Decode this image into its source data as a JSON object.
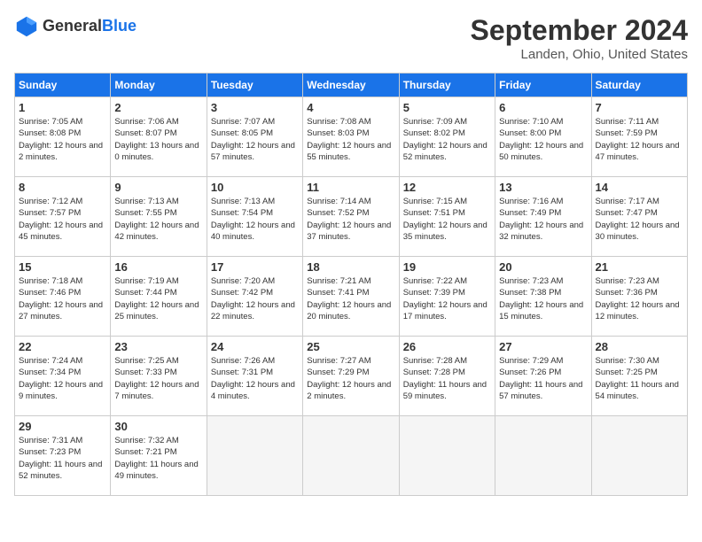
{
  "header": {
    "logo_general": "General",
    "logo_blue": "Blue",
    "month_year": "September 2024",
    "location": "Landen, Ohio, United States"
  },
  "days_of_week": [
    "Sunday",
    "Monday",
    "Tuesday",
    "Wednesday",
    "Thursday",
    "Friday",
    "Saturday"
  ],
  "weeks": [
    [
      {
        "day": 1,
        "sunrise": "7:05 AM",
        "sunset": "8:08 PM",
        "daylight": "12 hours and 2 minutes"
      },
      {
        "day": 2,
        "sunrise": "7:06 AM",
        "sunset": "8:07 PM",
        "daylight": "13 hours and 0 minutes"
      },
      {
        "day": 3,
        "sunrise": "7:07 AM",
        "sunset": "8:05 PM",
        "daylight": "12 hours and 57 minutes"
      },
      {
        "day": 4,
        "sunrise": "7:08 AM",
        "sunset": "8:03 PM",
        "daylight": "12 hours and 55 minutes"
      },
      {
        "day": 5,
        "sunrise": "7:09 AM",
        "sunset": "8:02 PM",
        "daylight": "12 hours and 52 minutes"
      },
      {
        "day": 6,
        "sunrise": "7:10 AM",
        "sunset": "8:00 PM",
        "daylight": "12 hours and 50 minutes"
      },
      {
        "day": 7,
        "sunrise": "7:11 AM",
        "sunset": "7:59 PM",
        "daylight": "12 hours and 47 minutes"
      }
    ],
    [
      {
        "day": 8,
        "sunrise": "7:12 AM",
        "sunset": "7:57 PM",
        "daylight": "12 hours and 45 minutes"
      },
      {
        "day": 9,
        "sunrise": "7:13 AM",
        "sunset": "7:55 PM",
        "daylight": "12 hours and 42 minutes"
      },
      {
        "day": 10,
        "sunrise": "7:13 AM",
        "sunset": "7:54 PM",
        "daylight": "12 hours and 40 minutes"
      },
      {
        "day": 11,
        "sunrise": "7:14 AM",
        "sunset": "7:52 PM",
        "daylight": "12 hours and 37 minutes"
      },
      {
        "day": 12,
        "sunrise": "7:15 AM",
        "sunset": "7:51 PM",
        "daylight": "12 hours and 35 minutes"
      },
      {
        "day": 13,
        "sunrise": "7:16 AM",
        "sunset": "7:49 PM",
        "daylight": "12 hours and 32 minutes"
      },
      {
        "day": 14,
        "sunrise": "7:17 AM",
        "sunset": "7:47 PM",
        "daylight": "12 hours and 30 minutes"
      }
    ],
    [
      {
        "day": 15,
        "sunrise": "7:18 AM",
        "sunset": "7:46 PM",
        "daylight": "12 hours and 27 minutes"
      },
      {
        "day": 16,
        "sunrise": "7:19 AM",
        "sunset": "7:44 PM",
        "daylight": "12 hours and 25 minutes"
      },
      {
        "day": 17,
        "sunrise": "7:20 AM",
        "sunset": "7:42 PM",
        "daylight": "12 hours and 22 minutes"
      },
      {
        "day": 18,
        "sunrise": "7:21 AM",
        "sunset": "7:41 PM",
        "daylight": "12 hours and 20 minutes"
      },
      {
        "day": 19,
        "sunrise": "7:22 AM",
        "sunset": "7:39 PM",
        "daylight": "12 hours and 17 minutes"
      },
      {
        "day": 20,
        "sunrise": "7:23 AM",
        "sunset": "7:38 PM",
        "daylight": "12 hours and 15 minutes"
      },
      {
        "day": 21,
        "sunrise": "7:23 AM",
        "sunset": "7:36 PM",
        "daylight": "12 hours and 12 minutes"
      }
    ],
    [
      {
        "day": 22,
        "sunrise": "7:24 AM",
        "sunset": "7:34 PM",
        "daylight": "12 hours and 9 minutes"
      },
      {
        "day": 23,
        "sunrise": "7:25 AM",
        "sunset": "7:33 PM",
        "daylight": "12 hours and 7 minutes"
      },
      {
        "day": 24,
        "sunrise": "7:26 AM",
        "sunset": "7:31 PM",
        "daylight": "12 hours and 4 minutes"
      },
      {
        "day": 25,
        "sunrise": "7:27 AM",
        "sunset": "7:29 PM",
        "daylight": "12 hours and 2 minutes"
      },
      {
        "day": 26,
        "sunrise": "7:28 AM",
        "sunset": "7:28 PM",
        "daylight": "11 hours and 59 minutes"
      },
      {
        "day": 27,
        "sunrise": "7:29 AM",
        "sunset": "7:26 PM",
        "daylight": "11 hours and 57 minutes"
      },
      {
        "day": 28,
        "sunrise": "7:30 AM",
        "sunset": "7:25 PM",
        "daylight": "11 hours and 54 minutes"
      }
    ],
    [
      {
        "day": 29,
        "sunrise": "7:31 AM",
        "sunset": "7:23 PM",
        "daylight": "11 hours and 52 minutes"
      },
      {
        "day": 30,
        "sunrise": "7:32 AM",
        "sunset": "7:21 PM",
        "daylight": "11 hours and 49 minutes"
      },
      null,
      null,
      null,
      null,
      null
    ]
  ]
}
